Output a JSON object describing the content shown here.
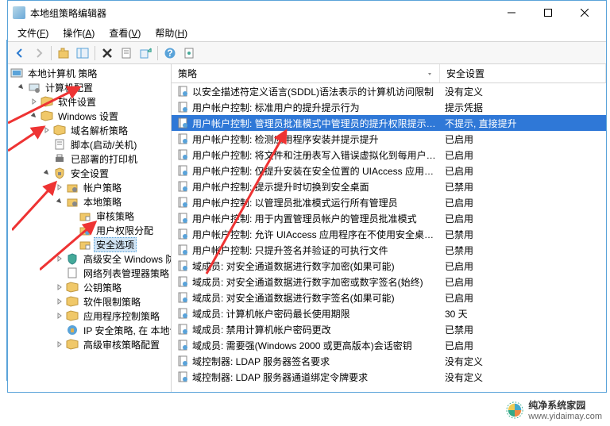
{
  "window": {
    "title": "本地组策略编辑器"
  },
  "menubar": [
    {
      "label": "文件",
      "key": "F"
    },
    {
      "label": "操作",
      "key": "A"
    },
    {
      "label": "查看",
      "key": "V"
    },
    {
      "label": "帮助",
      "key": "H"
    }
  ],
  "tree_root": "本地计算机 策略",
  "tree": {
    "computer_config": "计算机配置",
    "software_settings": "软件设置",
    "windows_settings": "Windows 设置",
    "dns_policy": "域名解析策略",
    "scripts": "脚本(启动/关机)",
    "printers": "已部署的打印机",
    "security_settings": "安全设置",
    "account_policy": "帐户策略",
    "local_policy": "本地策略",
    "audit_policy": "审核策略",
    "user_rights": "用户权限分配",
    "security_options": "安全选项",
    "advanced_sec": "高级安全 Windows 防火墙",
    "network_list": "网络列表管理器策略",
    "pubkey_policy": "公钥策略",
    "software_restrict": "软件限制策略",
    "app_control": "应用程序控制策略",
    "ip_security": "IP 安全策略, 在 本地计算机",
    "advanced_audit": "高级审核策略配置"
  },
  "columns": {
    "policy": "策略",
    "setting": "安全设置"
  },
  "rows": [
    {
      "p": "以安全描述符定义语言(SDDL)语法表示的计算机访问限制",
      "s": "没有定义"
    },
    {
      "p": "用户帐户控制: 标准用户的提升提示行为",
      "s": "提示凭据"
    },
    {
      "p": "用户帐户控制: 管理员批准模式中管理员的提升权限提示的行为",
      "s": "不提示, 直接提升",
      "selected": true
    },
    {
      "p": "用户帐户控制: 检测应用程序安装并提示提升",
      "s": "已启用"
    },
    {
      "p": "用户帐户控制: 将文件和注册表写入错误虚拟化到每用户位置",
      "s": "已启用"
    },
    {
      "p": "用户帐户控制: 仅提升安装在安全位置的 UIAccess 应用程序",
      "s": "已启用"
    },
    {
      "p": "用户帐户控制: 提示提升时切换到安全桌面",
      "s": "已禁用"
    },
    {
      "p": "用户帐户控制: 以管理员批准模式运行所有管理员",
      "s": "已启用"
    },
    {
      "p": "用户帐户控制: 用于内置管理员帐户的管理员批准模式",
      "s": "已启用"
    },
    {
      "p": "用户帐户控制: 允许 UIAccess 应用程序在不使用安全桌面的情况下提升",
      "s": "已禁用"
    },
    {
      "p": "用户帐户控制: 只提升签名并验证的可执行文件",
      "s": "已禁用"
    },
    {
      "p": "域成员: 对安全通道数据进行数字加密(如果可能)",
      "s": "已启用"
    },
    {
      "p": "域成员: 对安全通道数据进行数字加密或数字签名(始终)",
      "s": "已启用"
    },
    {
      "p": "域成员: 对安全通道数据进行数字签名(如果可能)",
      "s": "已启用"
    },
    {
      "p": "域成员: 计算机帐户密码最长使用期限",
      "s": "30 天"
    },
    {
      "p": "域成员: 禁用计算机帐户密码更改",
      "s": "已禁用"
    },
    {
      "p": "域成员: 需要强(Windows 2000 或更高版本)会话密钥",
      "s": "已启用"
    },
    {
      "p": "域控制器: LDAP 服务器签名要求",
      "s": "没有定义"
    },
    {
      "p": "域控制器: LDAP 服务器通道绑定令牌要求",
      "s": "没有定义"
    }
  ],
  "watermark": {
    "name": "纯净系统家园",
    "url": "www.yidaimay.com"
  }
}
